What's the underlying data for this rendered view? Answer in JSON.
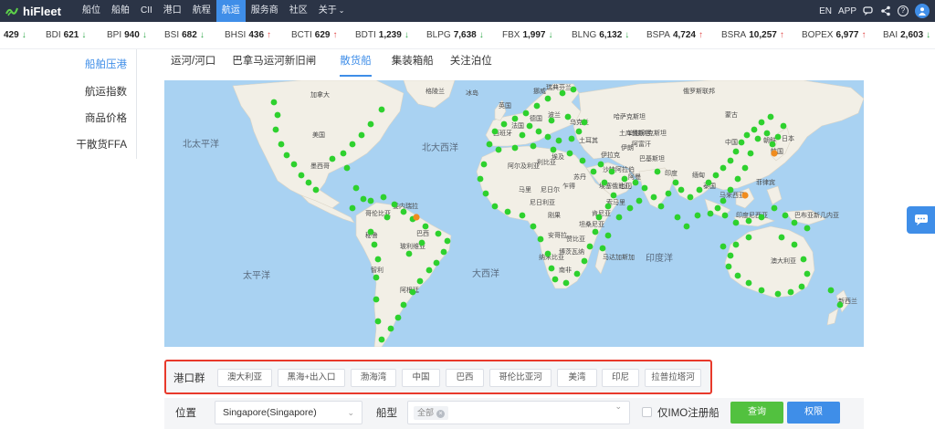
{
  "app": {
    "brand": "hiFleet"
  },
  "nav": {
    "items": [
      "船位",
      "船舶",
      "CII",
      "港口",
      "航程",
      "航运",
      "服务商",
      "社区",
      "关于"
    ],
    "active_index": 5
  },
  "topright": {
    "lang": "EN",
    "app": "APP"
  },
  "ticker": [
    {
      "name": "",
      "value": "429",
      "dir": "down"
    },
    {
      "name": "BDI",
      "value": "621",
      "dir": "down"
    },
    {
      "name": "BPI",
      "value": "940",
      "dir": "down"
    },
    {
      "name": "BSI",
      "value": "682",
      "dir": "down"
    },
    {
      "name": "BHSI",
      "value": "436",
      "dir": "up"
    },
    {
      "name": "BCTI",
      "value": "629",
      "dir": "up"
    },
    {
      "name": "BDTI",
      "value": "1,239",
      "dir": "down"
    },
    {
      "name": "BLPG",
      "value": "7,638",
      "dir": "down"
    },
    {
      "name": "FBX",
      "value": "1,997",
      "dir": "down"
    },
    {
      "name": "BLNG",
      "value": "6,132",
      "dir": "down"
    },
    {
      "name": "BSPA",
      "value": "4,724",
      "dir": "up"
    },
    {
      "name": "BSRA",
      "value": "10,257",
      "dir": "up"
    },
    {
      "name": "BOPEX",
      "value": "6,977",
      "dir": "up"
    },
    {
      "name": "BAI",
      "value": "2,603",
      "dir": "down"
    }
  ],
  "sidebar": {
    "items": [
      "船舶压港",
      "航运指数",
      "商品价格",
      "干散货FFA"
    ],
    "active_index": 0
  },
  "tabs": {
    "items": [
      "运河/河口",
      "巴拿马运河新旧闸",
      "散货船",
      "集装箱船",
      "关注泊位"
    ],
    "active_index": 2
  },
  "map": {
    "ocean_labels": [
      "北太平洋",
      "北大西洋",
      "太平洋",
      "大西洋",
      "印度洋"
    ],
    "region_labels": [
      "加拿大",
      "美国",
      "墨西哥",
      "哥伦比亚",
      "委内瑞拉",
      "秘鲁",
      "巴西",
      "玻利维亚",
      "阿根廷",
      "智利",
      "俄罗斯联邦",
      "哈萨克斯坦",
      "蒙古",
      "中国",
      "印度",
      "伊朗",
      "沙特阿拉伯",
      "埃及",
      "阿尔及利亚",
      "利比亚",
      "马里",
      "尼日尔",
      "乍得",
      "苏丹",
      "埃塞俄比亚",
      "尼日利亚",
      "刚果",
      "坦桑尼亚",
      "安哥拉",
      "南非",
      "马达加斯加",
      "澳大利亚",
      "印度尼西亚",
      "巴布亚新几内亚",
      "泰国",
      "日本",
      "土耳其",
      "西班牙",
      "法国",
      "德国",
      "英国",
      "挪威",
      "瑞典",
      "芬兰",
      "波兰",
      "乌克兰",
      "新西兰",
      "纳米比亚",
      "博茨瓦纳",
      "赞比亚",
      "肯尼亚",
      "索马里",
      "也门",
      "阿曼",
      "伊拉克",
      "阿富汗",
      "巴基斯坦",
      "土库曼斯坦",
      "乌兹别克斯坦",
      "缅甸",
      "马来西亚",
      "菲律宾",
      "韩国",
      "朝鲜",
      "冰岛",
      "格陵兰"
    ],
    "marker_colors": {
      "normal": "#2ed12e",
      "busy": "#f08c1e"
    }
  },
  "portGroup": {
    "label": "港口群",
    "buttons": [
      "澳大利亚",
      "黑海+出入口",
      "渤海湾",
      "中国",
      "巴西",
      "哥伦比亚河",
      "美湾",
      "印尼",
      "拉普拉塔河"
    ]
  },
  "filters": {
    "position_label": "位置",
    "position_value": "Singapore(Singapore)",
    "shiptype_label": "船型",
    "shiptype_tag": "全部",
    "imo_label": "仅IMO注册船",
    "query_btn": "查询",
    "perm_btn": "权限"
  },
  "colors": {
    "accent": "#3f8ee8",
    "topbar": "#2b3446",
    "up": "#e04848",
    "down": "#2fa84a",
    "ocean": "#a9d2f2",
    "land": "#f2efe6",
    "highlight_border": "#e8392b"
  }
}
